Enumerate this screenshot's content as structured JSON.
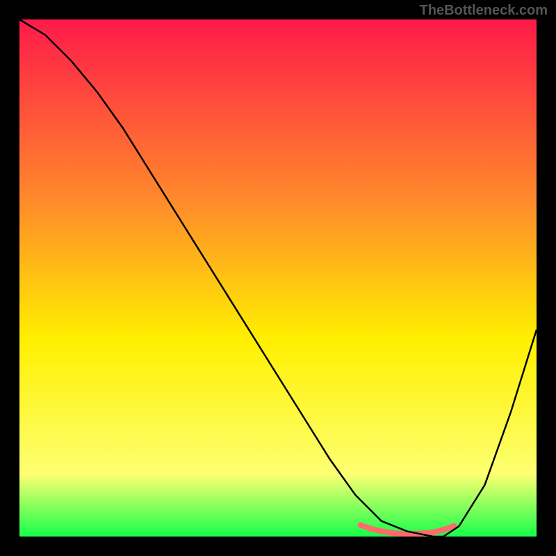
{
  "watermark": "TheBottleneck.com",
  "chart_data": {
    "type": "line",
    "title": "",
    "xlabel": "",
    "ylabel": "",
    "xlim": [
      0,
      100
    ],
    "ylim": [
      0,
      100
    ],
    "grid": false,
    "legend": false,
    "annotations": [],
    "background_gradient": {
      "top": "#ff1a4a",
      "mid1": "#ff8a2b",
      "mid2": "#fff000",
      "mid3": "#fdff72",
      "bottom": "#17ff4a"
    },
    "series": [
      {
        "name": "curve",
        "color": "#000000",
        "x": [
          0,
          5,
          10,
          15,
          20,
          25,
          30,
          35,
          40,
          45,
          50,
          55,
          60,
          65,
          70,
          75,
          80,
          82,
          85,
          90,
          95,
          100
        ],
        "y": [
          100,
          97,
          92,
          86,
          79,
          71,
          63,
          55,
          47,
          39,
          31,
          23,
          15,
          8,
          3,
          1,
          0,
          0,
          2,
          10,
          24,
          40
        ]
      }
    ],
    "highlight_band": {
      "color": "#ff6b6b",
      "x": [
        66,
        68,
        70,
        72,
        74,
        76,
        78,
        80,
        82,
        84
      ],
      "y": [
        2.2,
        1.5,
        1.0,
        0.7,
        0.5,
        0.5,
        0.6,
        0.8,
        1.3,
        2.0
      ],
      "dot_r": 4.5
    }
  }
}
